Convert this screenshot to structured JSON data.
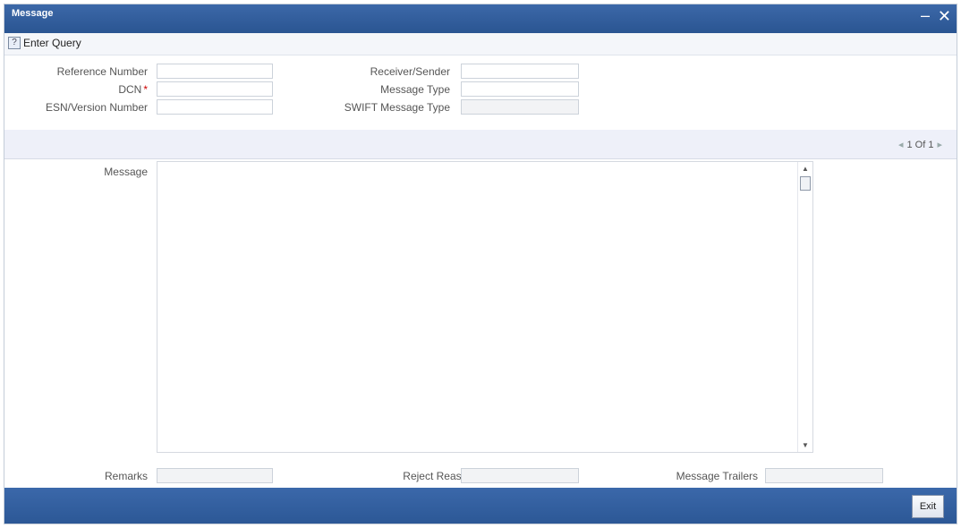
{
  "window": {
    "title": "Message",
    "minimize_glyph": "–",
    "close_glyph": "✕"
  },
  "toolbar": {
    "enter_query": "Enter Query",
    "icon": "query-icon"
  },
  "form": {
    "reference_number": {
      "label": "Reference Number",
      "value": ""
    },
    "dcn": {
      "label": "DCN",
      "required_mark": "*",
      "value": ""
    },
    "esn_version_number": {
      "label": "ESN/Version Number",
      "value": ""
    },
    "receiver_sender": {
      "label": "Receiver/Sender",
      "value": ""
    },
    "message_type": {
      "label": "Message Type",
      "value": ""
    },
    "swift_message_type": {
      "label": "SWIFT Message Type",
      "value": ""
    }
  },
  "pager": {
    "prev": "◂",
    "text": "1 Of 1",
    "next": "▸"
  },
  "message": {
    "label": "Message",
    "value": "",
    "scroll_up": "▲",
    "scroll_down": "▼"
  },
  "bottom_fields": {
    "remarks": {
      "label": "Remarks",
      "value": ""
    },
    "reject_reason": {
      "label": "Reject Reason",
      "value": ""
    },
    "message_trailers": {
      "label": "Message Trailers",
      "value": ""
    }
  },
  "footer": {
    "exit_label": "Exit"
  },
  "colors": {
    "header_blue": "#2f5b99",
    "pager_bg": "#eef0f9",
    "required": "#cc0000"
  }
}
